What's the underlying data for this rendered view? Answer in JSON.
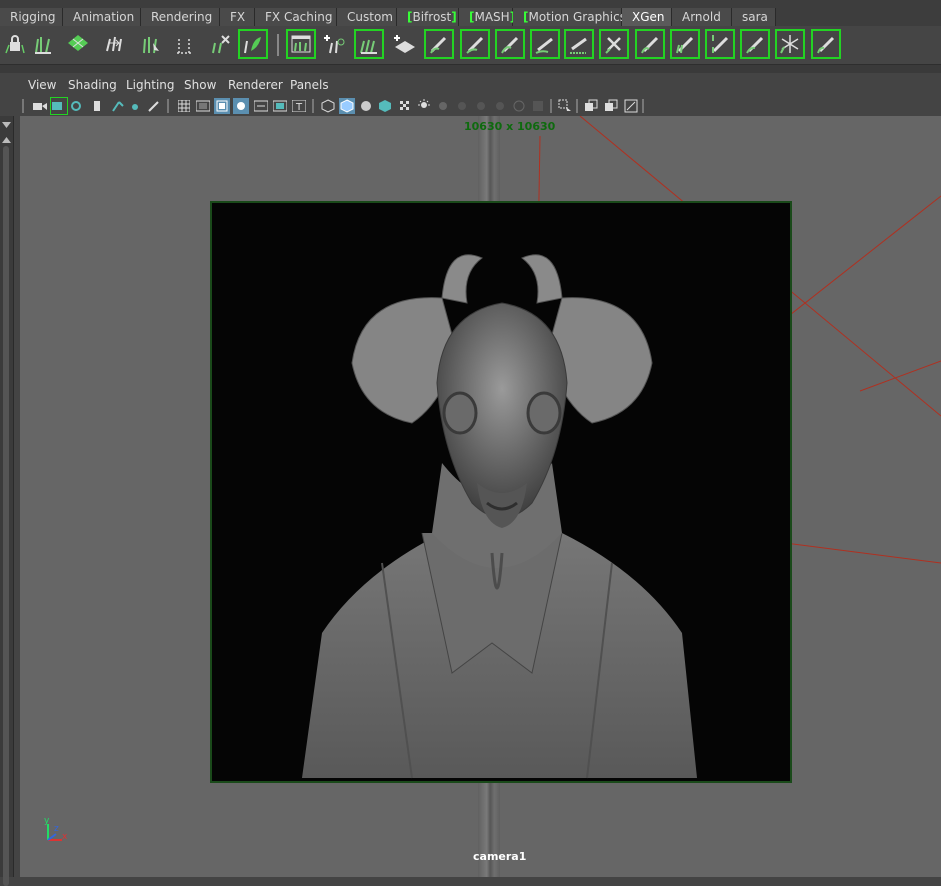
{
  "shelf_tabs": [
    {
      "label": "Rigging"
    },
    {
      "label": "Animation"
    },
    {
      "label": "Rendering"
    },
    {
      "label": "FX"
    },
    {
      "label": "FX Caching"
    },
    {
      "label": "Custom"
    },
    {
      "label": "Bifrost"
    },
    {
      "label": "MASH"
    },
    {
      "label": "Motion Graphics"
    },
    {
      "label": "XGen",
      "active": true
    },
    {
      "label": "Arnold"
    },
    {
      "label": "sara"
    }
  ],
  "shelf_icons": [
    "xgen-lock-icon",
    "xgen-grass-icon",
    "xgen-grid-plane-icon",
    "xgen-arrows-icon",
    "xgen-grass-select-icon",
    "xgen-brush-guide-icon",
    "xgen-cut-guide-icon",
    "xgen-leaf-icon",
    "xgen-editor-icon",
    "xgen-add-guide-icon",
    "xgen-comb-icon",
    "xgen-add-description-icon",
    "xgen-sculpt-brush-icon",
    "xgen-smooth-brush-icon",
    "xgen-twist-brush-icon",
    "xgen-bend-brush-icon",
    "xgen-width-brush-icon",
    "xgen-noise-brush-icon",
    "xgen-cut-brush-icon",
    "xgen-clump-brush-icon",
    "xgen-grab-brush-icon",
    "xgen-freeze-brush-icon",
    "xgen-pin-brush-icon",
    "xgen-snowflake-icon",
    "xgen-paint-brush-icon"
  ],
  "panel_menu": [
    "View",
    "Shading",
    "Lighting",
    "Show",
    "Renderer",
    "Panels"
  ],
  "panel_toolbar_icons": [
    "camera-select-icon",
    "camera-attributes-icon",
    "bookmark-icon",
    "image-plane-icon",
    "2d-pan-zoom-icon",
    "grease-pencil-icon",
    "grid-icon",
    "film-gate-icon",
    "resolution-gate-icon",
    "gate-mask-icon",
    "field-chart-icon",
    "safe-action-icon",
    "safe-title-icon",
    "wireframe-icon",
    "smooth-shade-icon",
    "wireframe-on-shaded-icon",
    "textured-icon",
    "xray-icon",
    "use-all-lights-icon",
    "shadows-icon",
    "screen-space-ao-icon",
    "motion-blur-icon",
    "multisample-aa-icon",
    "depth-of-field-icon",
    "isolate-select-icon",
    "xray-joints-icon",
    "xray-active-icon",
    "hud-icon"
  ],
  "viewport": {
    "resolution_label": "10630 x 10630",
    "camera_label": "camera1",
    "axis_labels": {
      "x": "x",
      "y": "y",
      "z": "z"
    }
  },
  "colors": {
    "shelf_highlight": "#23d323",
    "gate_border": "#1a4a1a",
    "resolution_label": "#0e6a0e",
    "light_lines": "#b03020"
  }
}
